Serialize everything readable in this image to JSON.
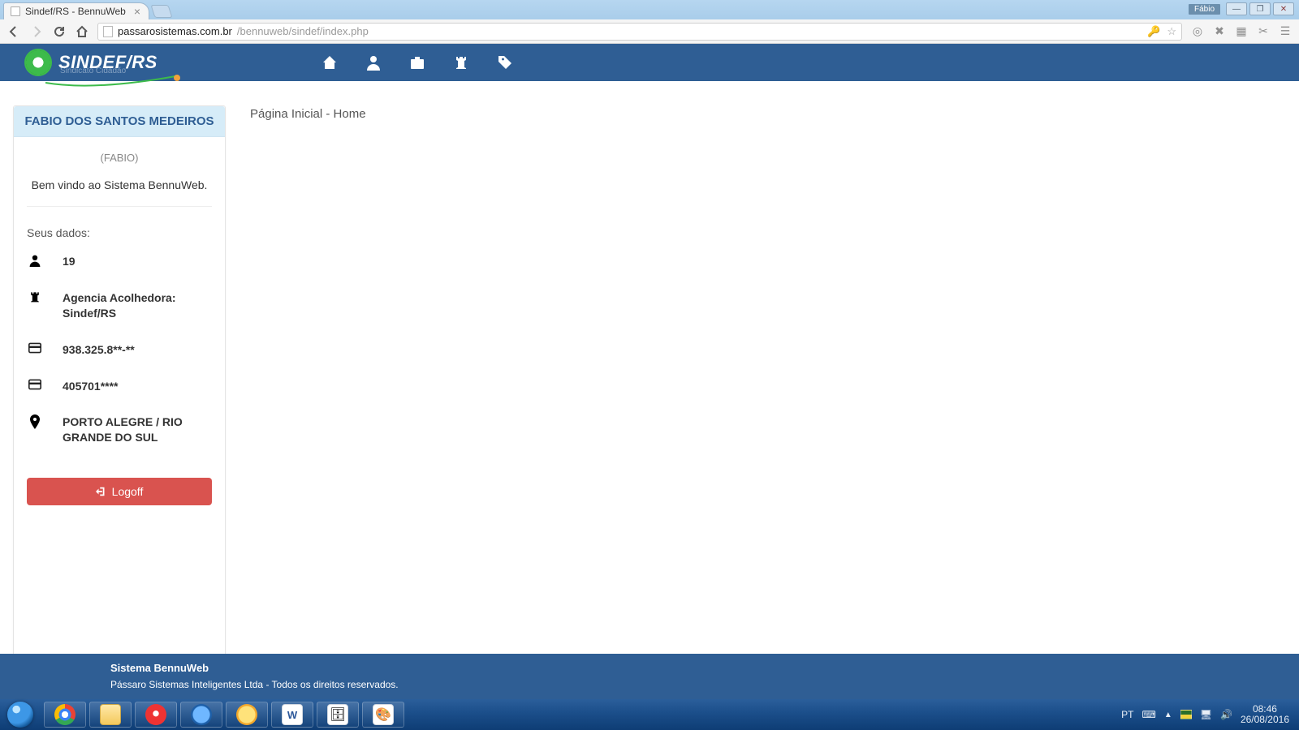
{
  "browser": {
    "tab_title": "Sindef/RS - BennuWeb",
    "user_badge": "Fábio",
    "url_host": "passarosistemas.com.br",
    "url_path": "/bennuweb/sindef/index.php"
  },
  "header": {
    "logo_text": "SINDEF/RS",
    "logo_sub": "Sindicato Cidadão"
  },
  "sidebar": {
    "name": "FABIO DOS SANTOS MEDEIROS",
    "nick": "(FABIO)",
    "welcome": "Bem vindo ao Sistema BennuWeb.",
    "section": "Seus dados:",
    "rows": {
      "id": "19",
      "agency": "Agencia Acolhedora: Sindef/RS",
      "doc1": "938.325.8**-**",
      "doc2": "405701****",
      "location": "PORTO ALEGRE / RIO GRANDE DO SUL"
    },
    "logoff": "Logoff"
  },
  "breadcrumb": "Página Inicial - Home",
  "footer": {
    "line1": "Sistema BennuWeb",
    "line2": "Pássaro Sistemas Inteligentes Ltda - Todos os direitos reservados."
  },
  "taskbar": {
    "lang": "PT",
    "time": "08:46",
    "date": "26/08/2016",
    "word_letter": "W"
  }
}
